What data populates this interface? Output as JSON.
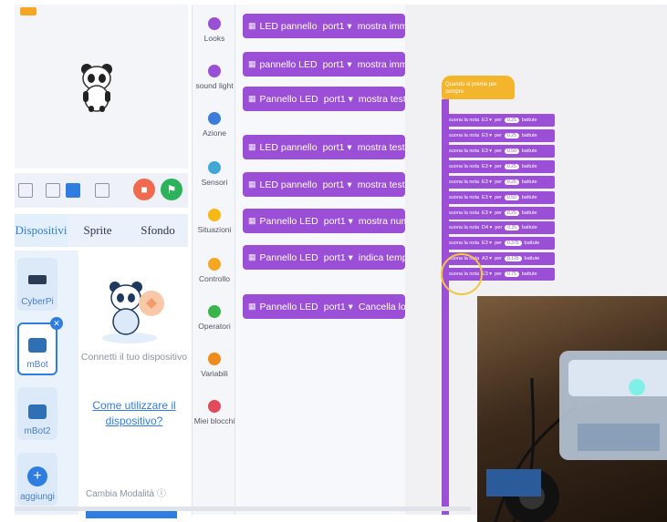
{
  "categories": [
    {
      "label": "Looks",
      "color": "#9b4fd6"
    },
    {
      "label": "sound light",
      "color": "#9b4fd6"
    },
    {
      "label": "Azione",
      "color": "#3b7ddd"
    },
    {
      "label": "Sensori",
      "color": "#41a7d6"
    },
    {
      "label": "Situazioni",
      "color": "#f5b814"
    },
    {
      "label": "Controllo",
      "color": "#f5a623"
    },
    {
      "label": "Operatori",
      "color": "#3ab54a"
    },
    {
      "label": "Variabili",
      "color": "#f08c1a"
    },
    {
      "label": "Miei blocchi",
      "color": "#e04a5a"
    }
  ],
  "blocks": [
    {
      "name": "LED pannello",
      "port": "port1 ▾",
      "action": "mostra imm"
    },
    {
      "name": "pannello LED",
      "port": "port1 ▾",
      "action": "mostra imm"
    },
    {
      "name": "Pannello LED",
      "port": "port1 ▾",
      "action": "mostra test"
    },
    {
      "name": "LED pannello",
      "port": "port1 ▾",
      "action": "mostra test"
    },
    {
      "name": "LED pannello",
      "port": "port1 ▾",
      "action": "mostra test"
    },
    {
      "name": "Pannello LED",
      "port": "port1 ▾",
      "action": "mostra num"
    },
    {
      "name": "Pannello LED",
      "port": "port1 ▾",
      "action": "indica temp"
    },
    {
      "name": "Pannello LED",
      "port": "port1 ▾",
      "action": "Cancella lo"
    }
  ],
  "tabs": [
    "Dispositivi",
    "Sprite",
    "Sfondo"
  ],
  "devices": [
    {
      "label": "CyberPi"
    },
    {
      "label": "mBot"
    },
    {
      "label": "mBot2"
    },
    {
      "label": "aggiungi"
    }
  ],
  "panel": {
    "connect_text": "Connetti il tuo dispositivo",
    "howto_text": "Come utilizzare il dispositivo?",
    "mode_label": "Cambia Modalità"
  },
  "script": {
    "hat_text": "Quando si preme per sempre",
    "note_label": "suona la nota",
    "note_values": [
      {
        "note": "E3 ▾",
        "beats": "0.25"
      },
      {
        "note": "E3 ▾",
        "beats": "0.25"
      },
      {
        "note": "E3 ▾",
        "beats": "0.50"
      },
      {
        "note": "E3 ▾",
        "beats": "0.25"
      },
      {
        "note": "E3 ▾",
        "beats": "0.25"
      },
      {
        "note": "E3 ▾",
        "beats": "0.50"
      },
      {
        "note": "E3 ▾",
        "beats": "0.25"
      },
      {
        "note": "D4 ▾",
        "beats": "0.25"
      },
      {
        "note": "E3 ▾",
        "beats": "0.375"
      },
      {
        "note": "A3 ▾",
        "beats": "0.125"
      },
      {
        "note": "E3 ▾",
        "beats": "0.75"
      }
    ],
    "per_label": "per",
    "beat_label": "battute"
  }
}
